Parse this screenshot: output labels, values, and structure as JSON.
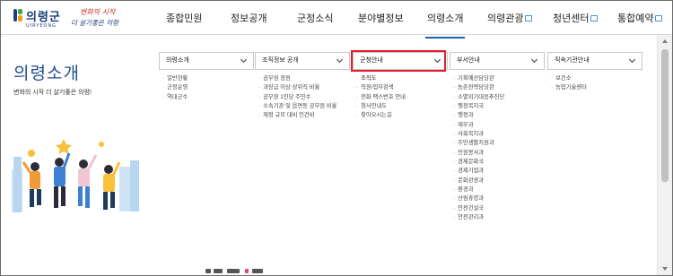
{
  "header": {
    "logo_name": "의령군",
    "logo_eng": "UIRYEONG",
    "slogan_line1": "변화의 시작",
    "slogan_line2": "더 살기좋은 의령",
    "nav": [
      {
        "label": "종합민원",
        "external": false,
        "active": false
      },
      {
        "label": "정보공개",
        "external": false,
        "active": false
      },
      {
        "label": "군정소식",
        "external": false,
        "active": false
      },
      {
        "label": "분야별정보",
        "external": false,
        "active": false
      },
      {
        "label": "의령소개",
        "external": false,
        "active": true
      },
      {
        "label": "의령관광",
        "external": true,
        "active": false
      },
      {
        "label": "청년센터",
        "external": true,
        "active": false
      },
      {
        "label": "통합예약",
        "external": true,
        "active": false
      }
    ]
  },
  "intro": {
    "title": "의령소개",
    "subtitle": "변화의 시작 더 살기좋은 의령!"
  },
  "columns": [
    {
      "label": "의령소개",
      "items": [
        "일반현황",
        "군정운영",
        "역대군수"
      ]
    },
    {
      "label": "조직정보 공개",
      "items": [
        "공무원 정원",
        "과장급 이상 상위직 비율",
        "공무원 1인당 주민수",
        "소속기관 및 읍면동 공무원 비율",
        "재정 규모 대비 인건비"
      ]
    },
    {
      "label": "군청안내",
      "items": [
        "조직도",
        "직원/업무검색",
        "전화 팩스번호 안내",
        "청사안내도",
        "찾아오시는길"
      ],
      "current_index": 0
    },
    {
      "label": "부서안내",
      "items": [
        "기획예산담당관",
        "농촌전략담당관",
        "소멸위기대응추진단",
        "행정복지국",
        "행정과",
        "재무과",
        "사회복지과",
        "주민생활지원과",
        "민원봉사과",
        "경제문화국",
        "경제기업과",
        "문화관광과",
        "환경과",
        "산림휴양과",
        "안전건설국",
        "안전관리과"
      ]
    },
    {
      "label": "직속기관안내",
      "items": [
        "보건소",
        "농업기술센터"
      ]
    }
  ],
  "colors": {
    "brand": "#1c3f7a",
    "title": "#1f4e8c",
    "highlight": "#e41e26",
    "active_underline": "#1f5fb0"
  }
}
